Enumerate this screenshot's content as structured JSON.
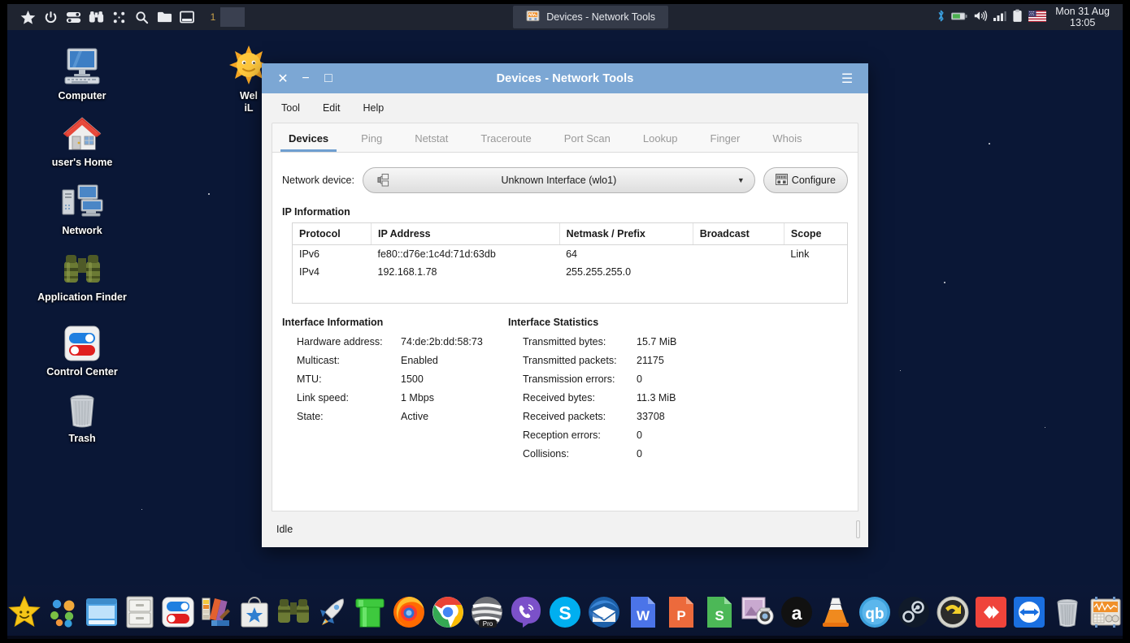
{
  "panel": {
    "launchers": [
      {
        "name": "whisker-menu-star-icon",
        "icon": "star"
      },
      {
        "name": "power-icon",
        "icon": "power"
      },
      {
        "name": "settings-toggle-icon",
        "icon": "toggle"
      },
      {
        "name": "application-finder-binoculars-icon",
        "icon": "binoculars"
      },
      {
        "name": "grid-apps-icon",
        "icon": "dots"
      },
      {
        "name": "search-icon",
        "icon": "search"
      },
      {
        "name": "file-manager-folder-icon",
        "icon": "folder"
      },
      {
        "name": "show-desktop-icon",
        "icon": "window"
      }
    ],
    "workspace_label": "1",
    "task_button_title": "Devices - Network Tools",
    "tray": [
      {
        "name": "bluetooth-icon",
        "icon": "bluetooth"
      },
      {
        "name": "battery-icon",
        "icon": "battery"
      },
      {
        "name": "volume-icon",
        "icon": "volume"
      },
      {
        "name": "network-signal-icon",
        "icon": "signal"
      },
      {
        "name": "clipboard-icon",
        "icon": "clipboard"
      },
      {
        "name": "keyboard-layout-flag-icon",
        "icon": "flag-us"
      }
    ],
    "clock_date": "Mon 31 Aug",
    "clock_time": "13:05"
  },
  "desktop": {
    "icons": [
      {
        "label": "Computer",
        "icon": "computer-monitor-icon"
      },
      {
        "label": "user's Home",
        "icon": "home-house-icon"
      },
      {
        "label": "Network",
        "icon": "network-computers-icon"
      },
      {
        "label": "Application Finder",
        "icon": "binoculars-icon"
      },
      {
        "label": "Control Center",
        "icon": "toggles-icon"
      },
      {
        "label": "Trash",
        "icon": "trash-bin-icon"
      },
      {
        "label": "Welcome to iLinux",
        "label_line1": "Wel",
        "label_line2": "iL",
        "icon": "sun-welcome-icon"
      }
    ]
  },
  "window": {
    "title": "Devices - Network Tools",
    "titlebar_buttons": {
      "close": "✕",
      "minimize": "−",
      "maximize": "□",
      "hamburger": "☰"
    },
    "accent_color": "#7ca7d4",
    "menus": [
      "Tool",
      "Edit",
      "Help"
    ],
    "tabs": [
      {
        "label": "Devices",
        "active": true
      },
      {
        "label": "Ping",
        "active": false
      },
      {
        "label": "Netstat",
        "active": false
      },
      {
        "label": "Traceroute",
        "active": false
      },
      {
        "label": "Port Scan",
        "active": false
      },
      {
        "label": "Lookup",
        "active": false
      },
      {
        "label": "Finger",
        "active": false
      },
      {
        "label": "Whois",
        "active": false
      }
    ],
    "device": {
      "label": "Network device:",
      "selected": "Unknown Interface (wlo1)",
      "arrow": "▼",
      "configure_label": "Configure"
    },
    "ip_information": {
      "title": "IP Information",
      "columns": [
        "Protocol",
        "IP Address",
        "Netmask / Prefix",
        "Broadcast",
        "Scope"
      ],
      "rows": [
        [
          "IPv6",
          "fe80::d76e:1c4d:71d:63db",
          "64",
          "",
          "Link"
        ],
        [
          "IPv4",
          "192.168.1.78",
          "255.255.255.0",
          "",
          ""
        ]
      ]
    },
    "interface_information": {
      "title": "Interface Information",
      "rows": [
        {
          "key": "Hardware address:",
          "value": "74:de:2b:dd:58:73"
        },
        {
          "key": "Multicast:",
          "value": "Enabled"
        },
        {
          "key": "MTU:",
          "value": "1500"
        },
        {
          "key": "Link speed:",
          "value": "1 Mbps"
        },
        {
          "key": "State:",
          "value": "Active"
        }
      ]
    },
    "interface_statistics": {
      "title": "Interface Statistics",
      "rows": [
        {
          "key": "Transmitted bytes:",
          "value": "15.7 MiB"
        },
        {
          "key": "Transmitted packets:",
          "value": "21175"
        },
        {
          "key": "Transmission errors:",
          "value": "0"
        },
        {
          "key": "Received bytes:",
          "value": "11.3 MiB"
        },
        {
          "key": "Received packets:",
          "value": "33708"
        },
        {
          "key": "Reception errors:",
          "value": "0"
        },
        {
          "key": "Collisions:",
          "value": "0"
        }
      ]
    },
    "status": "Idle"
  },
  "dock": {
    "items": [
      {
        "name": "whisker-star-launcher",
        "icon": "star-smile"
      },
      {
        "name": "app-grid-dots",
        "icon": "dots-color"
      },
      {
        "name": "window-manager",
        "icon": "blue-window"
      },
      {
        "name": "file-cabinet-archive",
        "icon": "cabinet"
      },
      {
        "name": "control-center",
        "icon": "toggles"
      },
      {
        "name": "color-palette-editor",
        "icon": "palette"
      },
      {
        "name": "app-store-bag",
        "icon": "store-bag"
      },
      {
        "name": "binoculars-finder",
        "icon": "binoculars"
      },
      {
        "name": "rocket-launcher",
        "icon": "rocket"
      },
      {
        "name": "green-pipe-utility",
        "icon": "pipe"
      },
      {
        "name": "firefox-browser",
        "icon": "firefox"
      },
      {
        "name": "google-chrome-browser",
        "icon": "chrome"
      },
      {
        "name": "opera-pro-browser",
        "icon": "opera-pro"
      },
      {
        "name": "viber-messenger",
        "icon": "viber"
      },
      {
        "name": "skype-messenger",
        "icon": "skype"
      },
      {
        "name": "thunderbird-mail",
        "icon": "thunderbird"
      },
      {
        "name": "word-processor",
        "icon": "writer-w"
      },
      {
        "name": "presentation-app",
        "icon": "impress-p"
      },
      {
        "name": "spreadsheet-app",
        "icon": "calc-s"
      },
      {
        "name": "screenshot-tool",
        "icon": "screenshot"
      },
      {
        "name": "amazon-store",
        "icon": "amazon-a"
      },
      {
        "name": "vlc-media-player",
        "icon": "vlc-cone"
      },
      {
        "name": "qbittorrent-client",
        "icon": "qbittorrent"
      },
      {
        "name": "steam-client",
        "icon": "steam"
      },
      {
        "name": "backup-restore-tool",
        "icon": "undo-shield"
      },
      {
        "name": "anydesk-remote",
        "icon": "anydesk"
      },
      {
        "name": "teamviewer-remote",
        "icon": "teamviewer"
      },
      {
        "name": "trash-bin",
        "icon": "trash"
      },
      {
        "name": "network-tools-monitor",
        "icon": "network-tools"
      }
    ]
  }
}
